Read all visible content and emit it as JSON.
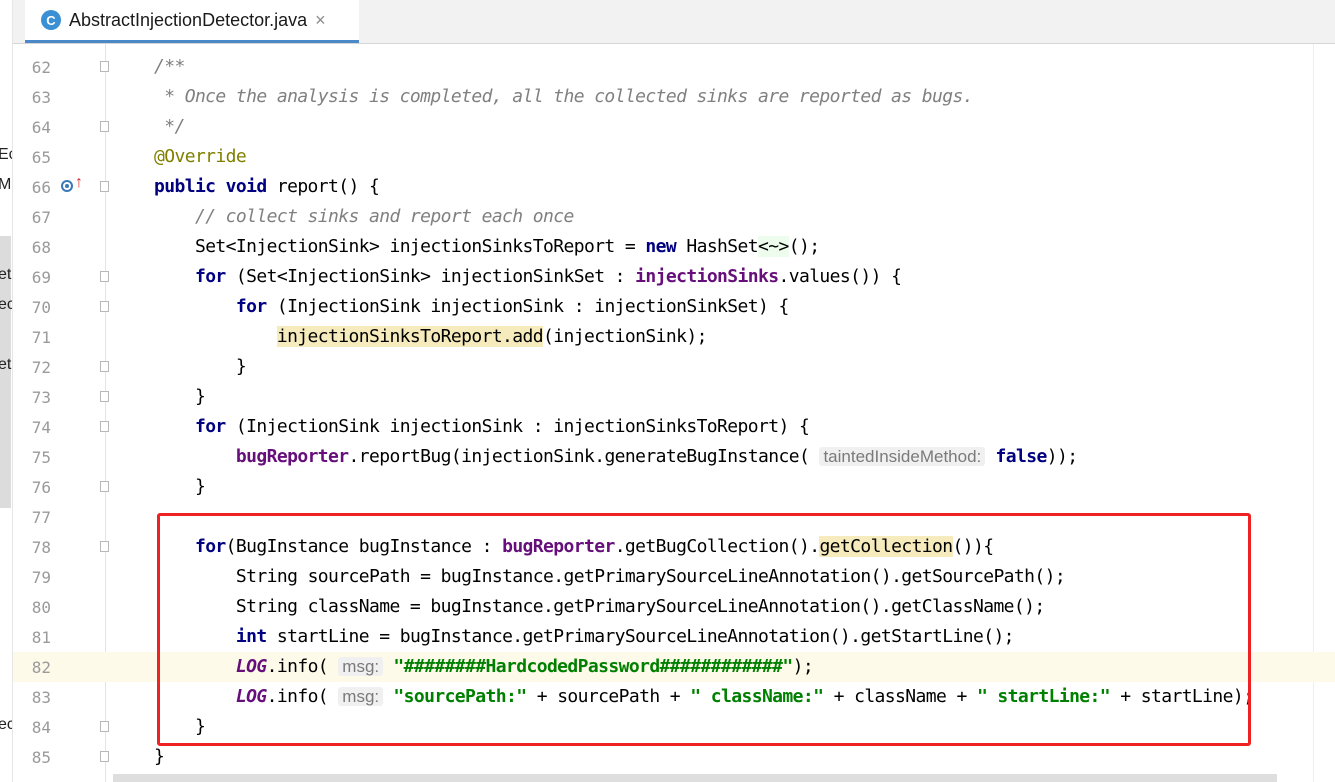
{
  "tab": {
    "icon": "C",
    "title": "AbstractInjectionDetector.java",
    "close": "×"
  },
  "sidebar_fragments": [
    "Ec",
    "M",
    "et",
    "ec",
    "et",
    "ec"
  ],
  "lines": [
    {
      "n": "62"
    },
    {
      "n": "63"
    },
    {
      "n": "64"
    },
    {
      "n": "65"
    },
    {
      "n": "66"
    },
    {
      "n": "67"
    },
    {
      "n": "68"
    },
    {
      "n": "69"
    },
    {
      "n": "70"
    },
    {
      "n": "71"
    },
    {
      "n": "72"
    },
    {
      "n": "73"
    },
    {
      "n": "74"
    },
    {
      "n": "75"
    },
    {
      "n": "76"
    },
    {
      "n": "77"
    },
    {
      "n": "78"
    },
    {
      "n": "79"
    },
    {
      "n": "80"
    },
    {
      "n": "81"
    },
    {
      "n": "82"
    },
    {
      "n": "83"
    },
    {
      "n": "84"
    },
    {
      "n": "85"
    }
  ],
  "code": {
    "l62": "/**",
    "l63": " * Once the analysis is completed, all the collected sinks are reported as bugs.",
    "l64": " */",
    "l65": "@Override",
    "l66_kw": "public void",
    "l66_rest": " report() {",
    "l67": "// collect sinks and report each once",
    "l68_a": "Set<InjectionSink> injectionSinksToReport = ",
    "l68_kw": "new",
    "l68_b": " HashSet",
    "l68_gen": "<~>",
    "l68_c": "();",
    "l69_kw": "for",
    "l69_a": " (Set<InjectionSink> injectionSinkSet : ",
    "l69_fld": "injectionSinks",
    "l69_b": ".values()) {",
    "l70_kw": "for",
    "l70_a": " (InjectionSink injectionSink : injectionSinkSet) {",
    "l71_mark": "injectionSinksToReport.add",
    "l71_a": "(injectionSink);",
    "l72": "}",
    "l73": "}",
    "l74_kw": "for",
    "l74_a": " (InjectionSink injectionSink : injectionSinksToReport) {",
    "l75_fld": "bugReporter",
    "l75_a": ".reportBug(injectionSink.generateBugInstance(",
    "l75_hint": "taintedInsideMethod:",
    "l75_kw": "false",
    "l75_b": "));",
    "l76": "}",
    "l78_kw": "for",
    "l78_a": "(BugInstance bugInstance : ",
    "l78_fld": "bugReporter",
    "l78_b": ".getBugCollection().",
    "l78_mark": "getCollection",
    "l78_c": "()){",
    "l79": "String sourcePath = bugInstance.getPrimarySourceLineAnnotation().getSourcePath();",
    "l80": "String className = bugInstance.getPrimarySourceLineAnnotation().getClassName();",
    "l81_kw": "int",
    "l81_a": " startLine = bugInstance.getPrimarySourceLineAnnotation().getStartLine();",
    "l82_stat": "LOG",
    "l82_a": ".info(",
    "l82_hint": "msg:",
    "l82_str": "\"########HardcodedPassword############\"",
    "l82_b": ");",
    "l83_stat": "LOG",
    "l83_a": ".info(",
    "l83_hint": "msg:",
    "l83_s1": "\"sourcePath:\"",
    "l83_b": " + sourcePath + ",
    "l83_s2": "\" className:\"",
    "l83_c": " + className + ",
    "l83_s3": "\" startLine:\"",
    "l83_d": " + startLine);",
    "l84": "}",
    "l85": "}"
  },
  "colors": {
    "keyword": "#000080",
    "comment": "#808080",
    "field": "#660e7a",
    "string": "#008000",
    "highlight_box": "#ee2222",
    "current_line": "#fdfae9"
  }
}
